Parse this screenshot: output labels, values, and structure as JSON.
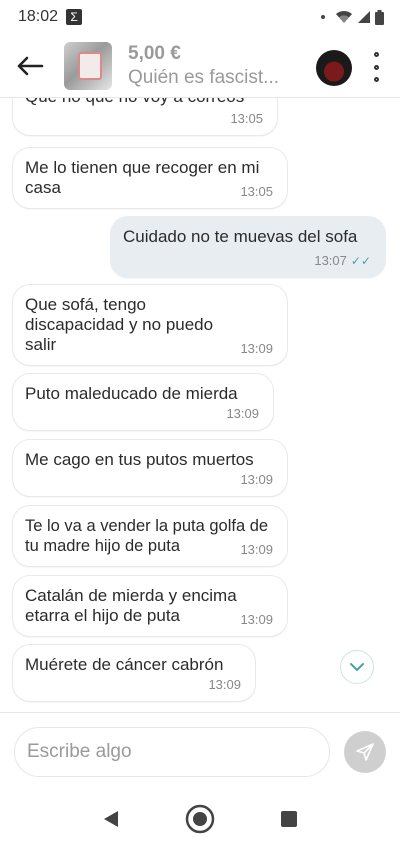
{
  "status_bar": {
    "time": "18:02",
    "notification_icon": "sigma-icon"
  },
  "header": {
    "price": "5,00 €",
    "subtitle": "Quién es fascist..."
  },
  "messages": [
    {
      "direction": "in",
      "text": "Que no que no voy a correos",
      "time": "13:05"
    },
    {
      "direction": "in",
      "text": "Me lo tienen que recoger en mi casa",
      "time": "13:05"
    },
    {
      "direction": "out",
      "text": "Cuidado no te muevas del sofa",
      "time": "13:07",
      "read": true
    },
    {
      "direction": "in",
      "text": "Que sofá, tengo discapacidad y no puedo salir",
      "time": "13:09"
    },
    {
      "direction": "in",
      "text": "Puto maleducado de mierda",
      "time": "13:09"
    },
    {
      "direction": "in",
      "text": "Me cago en tus putos muertos",
      "time": "13:09"
    },
    {
      "direction": "in",
      "text": "Te lo va a vender la puta golfa de tu madre hijo de puta",
      "time": "13:09"
    },
    {
      "direction": "in",
      "text": "Catalán de mierda y encima etarra el hijo de puta",
      "time": "13:09"
    },
    {
      "direction": "in",
      "text": "Muérete de cáncer cabrón",
      "time": "13:09"
    }
  ],
  "composer": {
    "placeholder": "Escribe algo"
  },
  "colors": {
    "accent": "#4aa0a8",
    "outgoing_bubble": "#e8edf1",
    "send_button": "#cfcfcf"
  }
}
